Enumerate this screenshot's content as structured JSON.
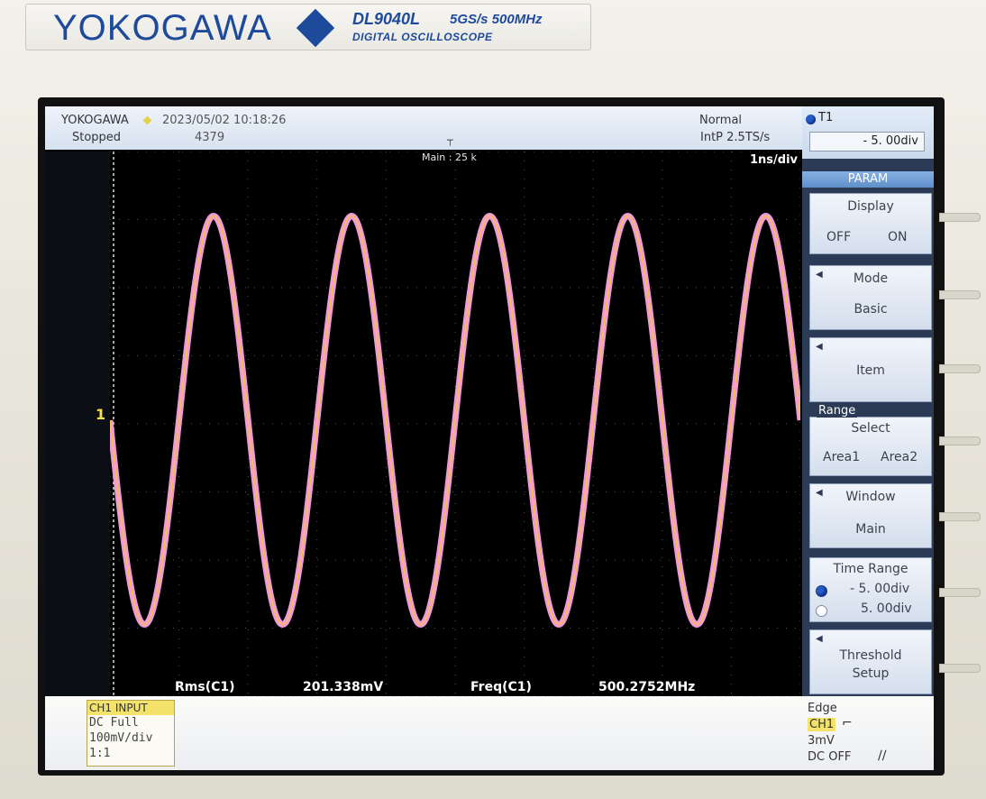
{
  "brand": {
    "name": "YOKOGAWA",
    "model": "DL9040L",
    "spec": "5GS/s 500MHz",
    "subtitle": "DIGITAL OSCILLOSCOPE"
  },
  "status": {
    "brand_mini": "YOKOGAWA",
    "datetime": "2023/05/02 10:18:26",
    "state": "Stopped",
    "acq_count": "4379",
    "trigger_mode": "Normal",
    "interp": "IntP  2.5TS/s"
  },
  "cursor_t1": {
    "label": "T1",
    "value": "- 5. 00div"
  },
  "display": {
    "main_zoom": "Main : 25 k",
    "time_div": "1ns/div",
    "trace_color": "#f29ad8",
    "trace_core_color": "#f3c24a",
    "gnd_marker": "1"
  },
  "waveform": {
    "cycles_visible": 5.0,
    "start_phase": 0.0,
    "amplitude_fraction": 0.75
  },
  "measurements": [
    {
      "name": "Rms(C1)",
      "value": "201.338mV"
    },
    {
      "name": "Freq(C1)",
      "value": "500.2752MHz"
    }
  ],
  "channel_info": {
    "header": "CH1 INPUT",
    "coupling": "DC Full",
    "vdiv": "100mV/div",
    "probe": "1:1"
  },
  "menu": {
    "title": "PARAM",
    "display": {
      "label": "Display",
      "off": "OFF",
      "on": "ON"
    },
    "mode": {
      "label": "Mode",
      "value": "Basic"
    },
    "item": {
      "label": "Item"
    },
    "range_tag": "Range",
    "select": {
      "label": "Select",
      "area1": "Area1",
      "area2": "Area2"
    },
    "window": {
      "label": "Window",
      "value": "Main"
    },
    "time_range": {
      "label": "Time Range",
      "start": "- 5. 00div",
      "end": "5. 00div"
    },
    "threshold": {
      "label1": "Threshold",
      "label2": "Setup"
    }
  },
  "trigger": {
    "type": "Edge",
    "source": "CH1",
    "level": "3mV",
    "hf": "DC OFF"
  }
}
